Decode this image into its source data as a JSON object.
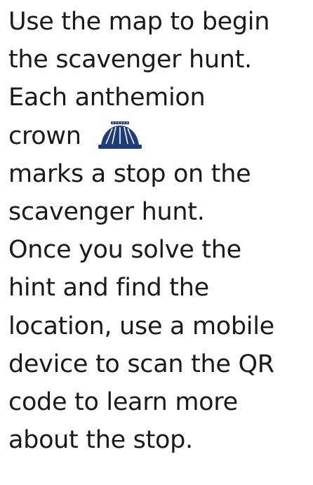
{
  "instructions": {
    "lines": [
      "Use the map to begin",
      "the scavenger hunt.",
      "Each anthemion",
      "crown",
      "marks a stop on the",
      "scavenger hunt.",
      "Once you solve the",
      "hint and find the",
      "location, use a mobile",
      "device to scan the QR",
      "code to learn more",
      "about the stop."
    ],
    "icon": "anthemion-crown-icon",
    "icon_color": "#1f3c78"
  }
}
